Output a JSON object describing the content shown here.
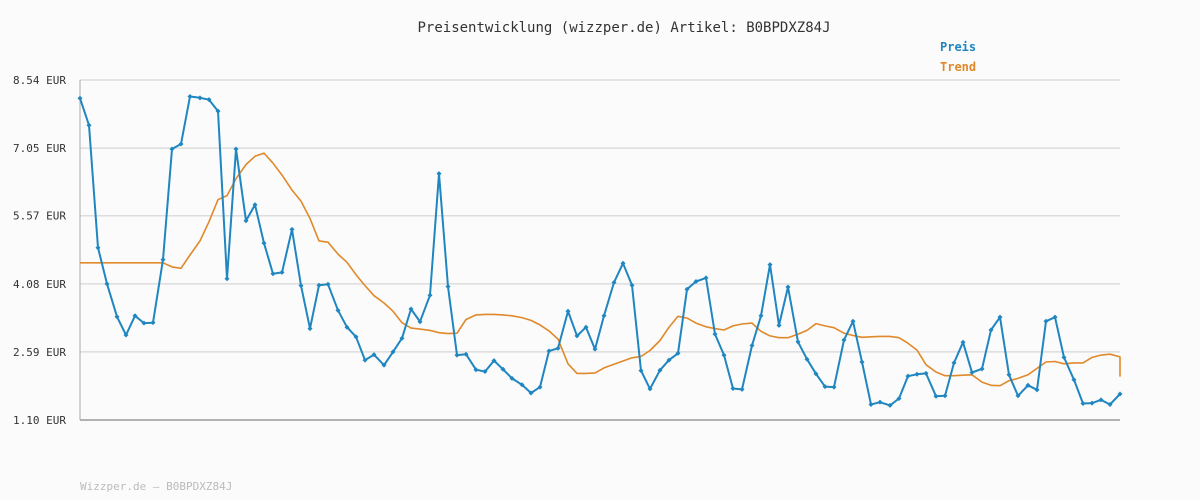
{
  "chart_data": {
    "type": "line",
    "title": "Preisentwicklung (wizzper.de) Artikel: B0BPDXZ84J",
    "ylim": [
      1.1,
      8.54
    ],
    "y_ticks": [
      "8.54 EUR",
      "7.05 EUR",
      "5.57 EUR",
      "4.08 EUR",
      "2.59 EUR",
      "1.10 EUR"
    ],
    "y_tick_values": [
      8.54,
      7.05,
      5.57,
      4.08,
      2.59,
      1.1
    ],
    "grid": true,
    "legend_position": "top-right",
    "series": [
      {
        "name": "Preis",
        "color": "#1f86c0",
        "markers": true,
        "values": [
          8.14,
          7.55,
          4.87,
          4.08,
          3.36,
          2.96,
          3.38,
          3.22,
          3.23,
          4.61,
          7.03,
          7.14,
          8.18,
          8.15,
          8.11,
          7.86,
          4.19,
          7.03,
          5.46,
          5.81,
          4.97,
          4.3,
          4.33,
          5.27,
          4.04,
          3.1,
          4.05,
          4.07,
          3.5,
          3.13,
          2.92,
          2.41,
          2.53,
          2.3,
          2.59,
          2.89,
          3.53,
          3.25,
          3.83,
          6.49,
          4.02,
          2.52,
          2.54,
          2.2,
          2.16,
          2.4,
          2.21,
          2.01,
          1.87,
          1.69,
          1.82,
          2.61,
          2.67,
          3.48,
          2.94,
          3.13,
          2.65,
          3.38,
          4.11,
          4.53,
          4.05,
          2.18,
          1.78,
          2.19,
          2.41,
          2.56,
          3.96,
          4.13,
          4.21,
          2.98,
          2.52,
          1.79,
          1.77,
          2.73,
          3.38,
          4.5,
          3.17,
          4.01,
          2.81,
          2.43,
          2.11,
          1.83,
          1.82,
          2.85,
          3.26,
          2.37,
          1.44,
          1.49,
          1.42,
          1.57,
          2.06,
          2.1,
          2.12,
          1.62,
          1.63,
          2.35,
          2.8,
          2.14,
          2.22,
          3.07,
          3.35,
          2.09,
          1.63,
          1.86,
          1.76,
          3.26,
          3.35,
          2.47,
          1.98,
          1.46,
          1.47,
          1.54,
          1.44,
          1.67
        ],
        "x_positions": [
          80,
          89,
          98,
          107,
          117,
          126,
          135,
          144,
          153,
          163,
          172,
          181,
          190,
          200,
          209,
          218,
          227,
          236,
          246,
          255,
          264,
          273,
          282,
          292,
          301,
          310,
          319,
          328,
          338,
          347,
          356,
          365,
          374,
          384,
          393,
          402,
          411,
          420,
          430,
          439,
          448,
          457,
          466,
          476,
          485,
          494,
          503,
          512,
          522,
          531,
          540,
          549,
          558,
          568,
          577,
          586,
          595,
          604,
          614,
          623,
          632,
          641,
          650,
          660,
          669,
          678,
          687,
          696,
          706,
          715,
          724,
          733,
          742,
          752,
          761,
          770,
          779,
          788,
          798,
          807,
          816,
          825,
          834,
          844,
          853,
          862,
          871,
          880,
          890,
          899,
          908,
          917,
          926,
          936,
          945,
          954,
          963,
          972,
          982,
          991,
          1000,
          1009,
          1018,
          1028,
          1037,
          1046,
          1055,
          1064,
          1074,
          1083,
          1092,
          1101,
          1110,
          1120
        ]
      },
      {
        "name": "Trend",
        "color": "#e0892a",
        "markers": false,
        "values": [
          4.54,
          4.54,
          4.54,
          4.54,
          4.54,
          4.54,
          4.54,
          4.54,
          4.54,
          4.54,
          4.45,
          4.42,
          4.71,
          5.02,
          5.44,
          5.92,
          6.01,
          6.38,
          6.69,
          6.87,
          6.94,
          6.72,
          6.46,
          6.13,
          5.89,
          5.51,
          5.02,
          4.99,
          4.73,
          4.55,
          4.28,
          4.04,
          3.82,
          3.66,
          3.48,
          3.23,
          3.11,
          3.09,
          3.06,
          3.01,
          2.99,
          3.0,
          3.3,
          3.4,
          3.41,
          3.41,
          3.4,
          3.38,
          3.34,
          3.28,
          3.18,
          3.05,
          2.87,
          2.33,
          2.12,
          2.12,
          2.13,
          2.24,
          2.32,
          2.39,
          2.46,
          2.49,
          2.62,
          2.84,
          3.13,
          3.37,
          3.33,
          3.22,
          3.14,
          3.1,
          3.07,
          3.16,
          3.2,
          3.22,
          3.04,
          2.94,
          2.9,
          2.9,
          2.98,
          3.06,
          3.21,
          3.16,
          3.12,
          3.0,
          2.95,
          2.91,
          2.92,
          2.93,
          2.93,
          2.9,
          2.78,
          2.63,
          2.31,
          2.15,
          2.07,
          2.07,
          2.08,
          2.09,
          1.93,
          1.86,
          1.85,
          1.96,
          2.01,
          2.09,
          2.23,
          2.37,
          2.38,
          2.33,
          2.35,
          2.35,
          2.47,
          2.52,
          2.54,
          2.48,
          2.3,
          2.1,
          2.07,
          2.07,
          2.05
        ],
        "x_positions": [
          80,
          89,
          98,
          107,
          117,
          126,
          135,
          144,
          153,
          163,
          172,
          181,
          190,
          200,
          209,
          218,
          227,
          236,
          246,
          255,
          264,
          273,
          282,
          292,
          301,
          310,
          319,
          328,
          338,
          347,
          356,
          365,
          374,
          384,
          393,
          402,
          411,
          420,
          430,
          439,
          448,
          457,
          466,
          476,
          485,
          494,
          503,
          512,
          522,
          531,
          540,
          549,
          558,
          568,
          577,
          586,
          595,
          604,
          614,
          623,
          632,
          641,
          650,
          660,
          669,
          678,
          687,
          696,
          706,
          715,
          724,
          733,
          742,
          752,
          761,
          770,
          779,
          788,
          798,
          807,
          816,
          825,
          834,
          844,
          853,
          862,
          871,
          880,
          890,
          899,
          908,
          917,
          926,
          936,
          945,
          954,
          963,
          972,
          982,
          991,
          1000,
          1009,
          1018,
          1028,
          1037,
          1046,
          1055,
          1064,
          1074,
          1083,
          1092,
          1101,
          1110,
          1120,
          1128,
          1138,
          1148,
          1158,
          1168
        ]
      }
    ]
  },
  "footer": "Wizzper.de – B0BPDXZ84J",
  "colors": {
    "grid": "#dddddd",
    "axis": "#999999",
    "background": "#fbfbfb"
  }
}
